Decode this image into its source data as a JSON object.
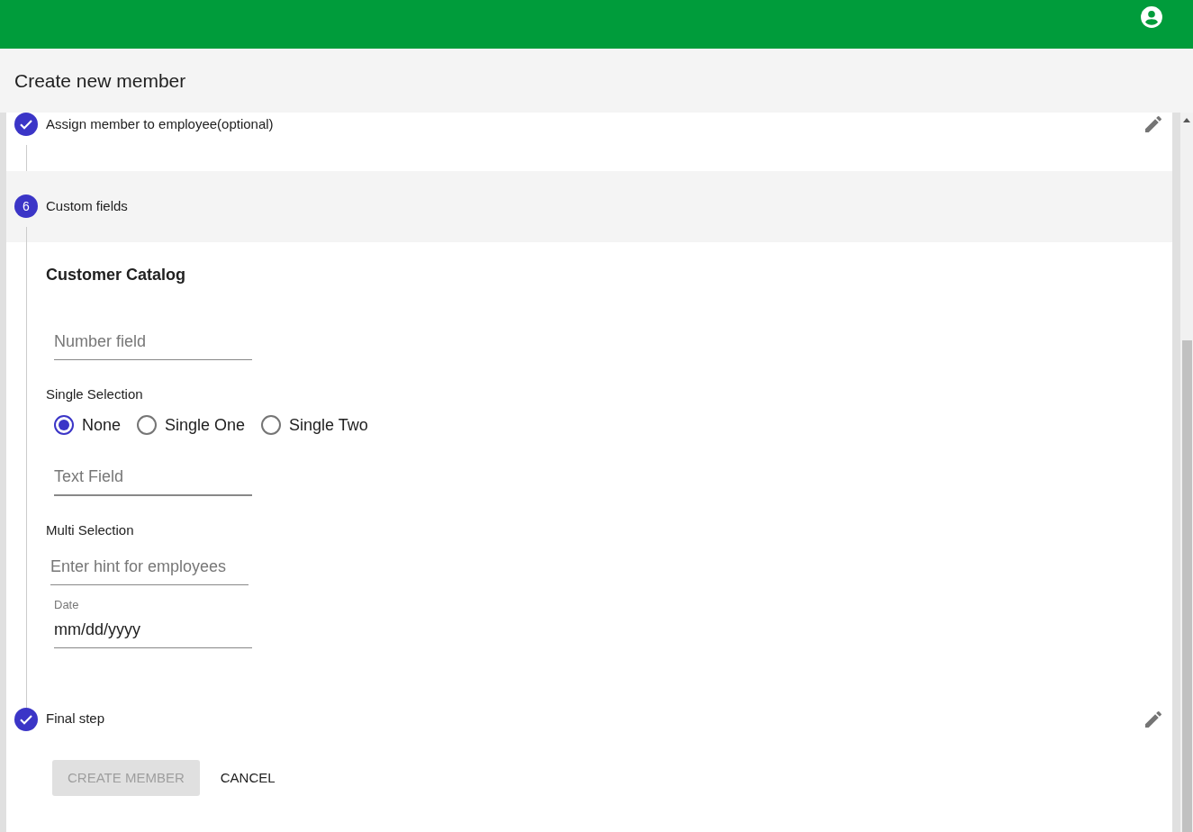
{
  "page_title": "Create new member",
  "steps": [
    {
      "label": "Assign member to employee(optional)",
      "completed": true,
      "active": false,
      "editable": true
    },
    {
      "label": "Custom fields",
      "completed": false,
      "active": true,
      "number": "6",
      "editable": false
    },
    {
      "label": "Final step",
      "completed": true,
      "active": false,
      "editable": true
    }
  ],
  "custom_fields": {
    "section_title": "Customer Catalog",
    "fields": [
      {
        "kind": "text",
        "placeholder": "Number field"
      },
      {
        "kind": "radio",
        "label": "Single Selection",
        "options": [
          {
            "label": "None",
            "selected": true
          },
          {
            "label": "Single One",
            "selected": false
          },
          {
            "label": "Single Two",
            "selected": false
          }
        ]
      },
      {
        "kind": "text",
        "placeholder": "Text Field"
      },
      {
        "kind": "multi",
        "label": "Multi Selection",
        "placeholder": "Enter hint for employees"
      },
      {
        "kind": "date",
        "label": "Date",
        "value": "mm/dd/yyyy"
      }
    ]
  },
  "actions": [
    {
      "label": "CREATE MEMBER",
      "disabled": true
    },
    {
      "label": "CANCEL",
      "disabled": false
    }
  ]
}
